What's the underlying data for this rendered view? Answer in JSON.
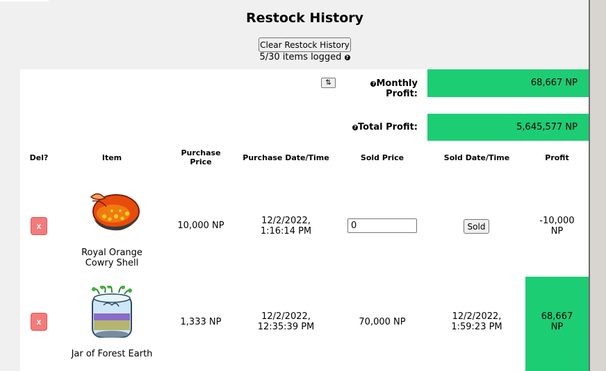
{
  "header": {
    "title": "Restock History",
    "clear_button_label": "Clear Restock History",
    "items_logged": "5/30 items logged",
    "help_glyph": "?"
  },
  "summary": {
    "sort_glyph": "⇅",
    "monthly_label": "Monthly Profit:",
    "monthly_value": "68,667 NP",
    "total_label": "Total Profit:",
    "total_value": "5,645,577 NP",
    "help_glyph": "?"
  },
  "table": {
    "headers": {
      "del": "Del?",
      "item": "Item",
      "purchase_price_1": "Purchase",
      "purchase_price_2": "Price",
      "purchase_datetime": "Purchase Date/Time",
      "sold_price": "Sold Price",
      "sold_datetime": "Sold Date/Time",
      "profit": "Profit"
    },
    "rows": [
      {
        "delete_glyph": "x",
        "item_name_1": "Royal Orange",
        "item_name_2": "Cowry Shell",
        "item_icon": "orange-cowry-shell-icon",
        "purchase_price": "10,000 NP",
        "purchase_date": "12/2/2022,",
        "purchase_time": "1:16:14 PM",
        "sold_price_value": "0",
        "sold_button_label": "Sold",
        "profit_1": "-10,000",
        "profit_2": "NP"
      },
      {
        "delete_glyph": "x",
        "item_name_1": "Jar of Forest Earth",
        "item_icon": "forest-earth-jar-icon",
        "purchase_price": "1,333 NP",
        "purchase_date": "12/2/2022,",
        "purchase_time": "12:35:39 PM",
        "sold_price": "70,000 NP",
        "sold_date": "12/2/2022,",
        "sold_time": "1:59:23 PM",
        "profit_1": "68,667",
        "profit_2": "NP",
        "profit_color": "#1ccd74"
      }
    ]
  },
  "colors": {
    "profit_green": "#1ccd74",
    "delete_red": "#f47b7b"
  }
}
